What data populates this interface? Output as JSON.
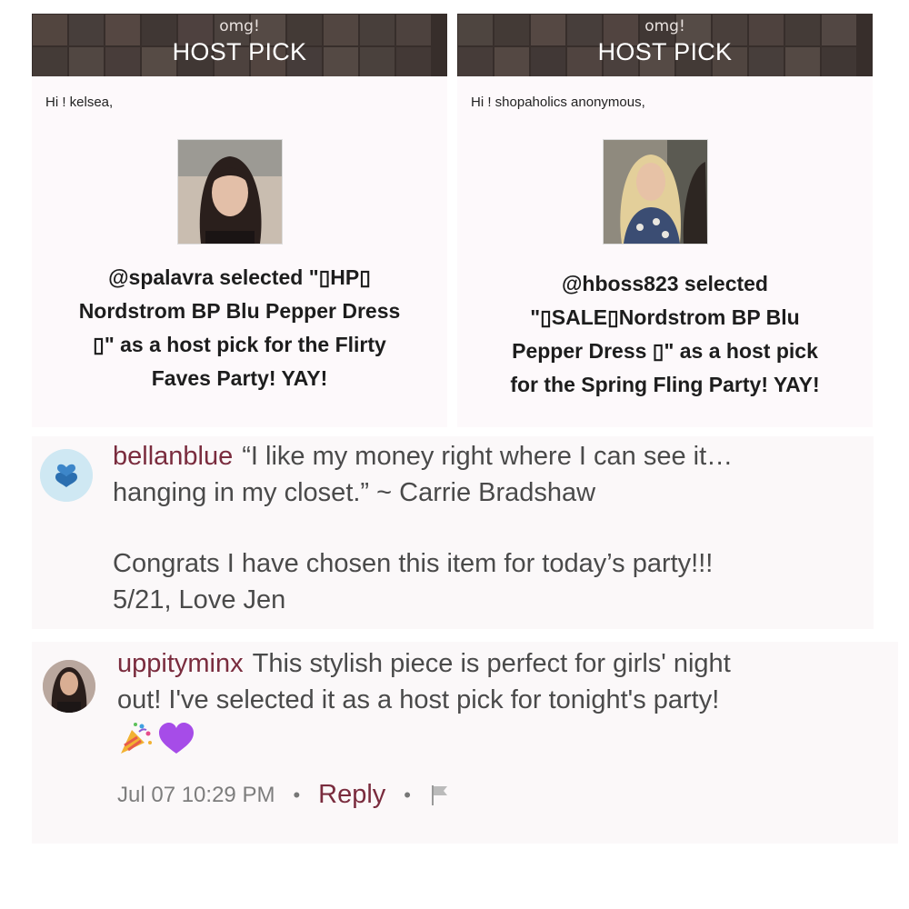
{
  "host_picks": [
    {
      "omg": "omg!",
      "title": "HOST PICK",
      "greeting": "Hi ! kelsea,",
      "lines": [
        "@spalavra selected \"▯HP▯",
        "Nordstrom BP Blu Pepper Dress",
        "▯\" as a host pick for the Flirty",
        "Faves Party! YAY!"
      ]
    },
    {
      "omg": "omg!",
      "title": "HOST PICK",
      "greeting": "Hi ! shopaholics anonymous,",
      "lines": [
        "@hboss823 selected",
        "\"▯SALE▯Nordstrom BP Blu",
        "Pepper Dress ▯\" as a host pick",
        "for the Spring Fling Party! YAY!"
      ]
    }
  ],
  "comments": [
    {
      "username": "bellanblue",
      "lines": [
        "“I like my money right where I can see it…",
        "hanging in my closet.” ~ Carrie Bradshaw"
      ],
      "lines2": [
        "Congrats I have chosen this item for today’s party!!!",
        "5/21, Love Jen"
      ]
    },
    {
      "username": "uppityminx",
      "lines": [
        "This stylish piece is perfect for girls' night",
        "out! I've selected it as a host pick for tonight's party!"
      ],
      "emojis": [
        "party-popper-icon",
        "purple-heart-icon"
      ],
      "timestamp": "Jul 07 10:29 PM",
      "reply_label": "Reply"
    }
  ],
  "colors": {
    "username": "#7a2c3e",
    "banner": "#4a3f3c",
    "card_bg": "#fdf9fb"
  }
}
